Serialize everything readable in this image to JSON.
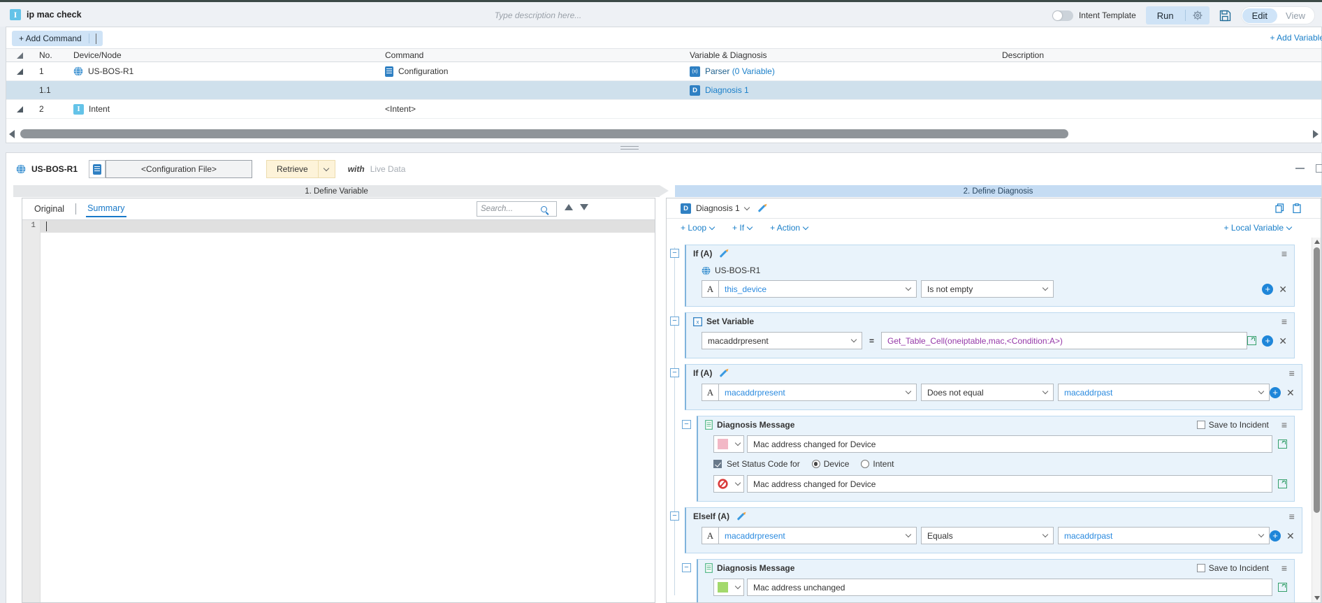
{
  "topbar": {
    "title": "ip mac check",
    "description_placeholder": "Type description here...",
    "intent_template_label": "Intent Template",
    "run_label": "Run",
    "edit_label": "Edit",
    "view_label": "View"
  },
  "commands": {
    "add_command_label": "+ Add Command",
    "add_variable_label": "+ Add Variable",
    "columns": {
      "no": "No.",
      "device": "Device/Node",
      "command": "Command",
      "variable": "Variable & Diagnosis",
      "description": "Description"
    },
    "row1": {
      "no": "1",
      "device": "US-BOS-R1",
      "command": "Configuration",
      "parser_label": "Parser",
      "parser_count": "(0 Variable)"
    },
    "row11": {
      "no": "1.1",
      "diagnosis": "Diagnosis 1"
    },
    "row2": {
      "no": "2",
      "device": "Intent",
      "command": "<Intent>"
    }
  },
  "detail": {
    "device": "US-BOS-R1",
    "config_file": "<Configuration File>",
    "retrieve_label": "Retrieve",
    "with_label": "with",
    "live_data_label": "Live Data",
    "step1": "1. Define Variable",
    "step2": "2. Define Diagnosis",
    "tab_original": "Original",
    "tab_summary": "Summary",
    "search_placeholder": "Search...",
    "line_number": "1"
  },
  "diagnosis": {
    "name": "Diagnosis 1",
    "icon_letter": "D",
    "parser_icon_label": "(x)",
    "toolbar": {
      "loop": "+ Loop",
      "if_label": "+ If",
      "action": "+ Action",
      "local_variable": "+ Local Variable"
    },
    "if1": {
      "title": "If (A)",
      "device": "US-BOS-R1",
      "operand": "A",
      "variable": "this_device",
      "operator": "Is not empty"
    },
    "set_var": {
      "title": "Set Variable",
      "variable": "macaddrpresent",
      "equals": "=",
      "expression": "Get_Table_Cell(oneiptable,mac,<Condition:A>)"
    },
    "if2": {
      "title": "If (A)",
      "operand": "A",
      "variable": "macaddrpresent",
      "operator": "Does not equal",
      "value": "macaddrpast"
    },
    "msg1": {
      "title": "Diagnosis Message",
      "save_label": "Save to Incident",
      "message": "Mac address changed for Device",
      "status_label": "Set Status Code for",
      "radio_device": "Device",
      "radio_intent": "Intent",
      "status_message": "Mac address changed for Device",
      "severity_color": "#f2b8c6"
    },
    "elseif1": {
      "title": "ElseIf (A)",
      "operand": "A",
      "variable": "macaddrpresent",
      "operator": "Equals",
      "value": "macaddrpast"
    },
    "msg2": {
      "title": "Diagnosis Message",
      "save_label": "Save to Incident",
      "message": "Mac address unchanged",
      "severity_color": "#a3d96c"
    }
  }
}
